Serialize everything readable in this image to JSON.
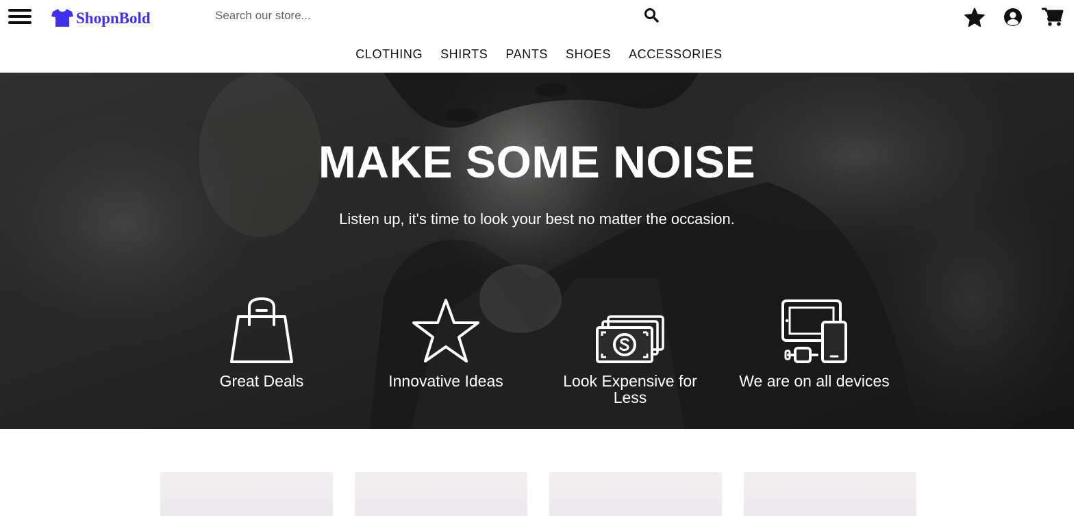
{
  "header": {
    "menu_icon": "hamburger-menu-icon",
    "logo": {
      "icon": "tshirt-icon",
      "text": "ShopnBold",
      "color": "#3f2ff0"
    },
    "search": {
      "placeholder": "Search our store...",
      "value": "",
      "icon": "search-icon"
    },
    "icons": [
      {
        "name": "favorites",
        "icon": "star-icon"
      },
      {
        "name": "account",
        "icon": "user-circle-icon"
      },
      {
        "name": "cart",
        "icon": "cart-icon"
      }
    ]
  },
  "nav": {
    "items": [
      "CLOTHING",
      "SHIRTS",
      "PANTS",
      "SHOES",
      "ACCESSORIES"
    ]
  },
  "hero": {
    "title": "MAKE SOME NOISE",
    "subtitle": "Listen up, it's time to look your best no matter the occasion.",
    "features": [
      {
        "label": "Great Deals",
        "icon": "shopping-bag-icon"
      },
      {
        "label": "Innovative Ideas",
        "icon": "star-outline-icon"
      },
      {
        "label": "Look Expensive for Less",
        "icon": "money-stack-icon"
      },
      {
        "label": "We are on all devices",
        "icon": "devices-icon"
      }
    ]
  },
  "products": {
    "count_visible": 4
  },
  "colors": {
    "brand": "#3f2ff0",
    "text": "#111111",
    "hero_overlay": "#2b2b2b",
    "card_bg": "#efebee"
  }
}
